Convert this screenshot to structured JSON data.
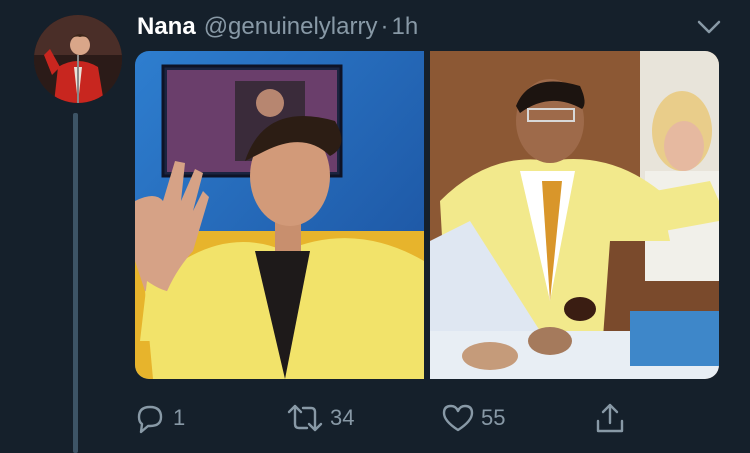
{
  "tweet": {
    "author_name": "Nana",
    "handle": "@genuinelylarry",
    "separator": "·",
    "timestamp": "1h"
  },
  "media": {
    "photos": [
      {
        "label": "photo-left"
      },
      {
        "label": "photo-right"
      }
    ]
  },
  "actions": {
    "replies": "1",
    "retweets": "34",
    "likes": "55"
  },
  "icons": {
    "reply": "reply-icon",
    "retweet": "retweet-icon",
    "like": "like-icon",
    "share": "share-icon",
    "caret": "chevron-down-icon"
  },
  "colors": {
    "background": "#15202b",
    "muted_text": "#8899a6",
    "thread_line": "#3d5466"
  }
}
